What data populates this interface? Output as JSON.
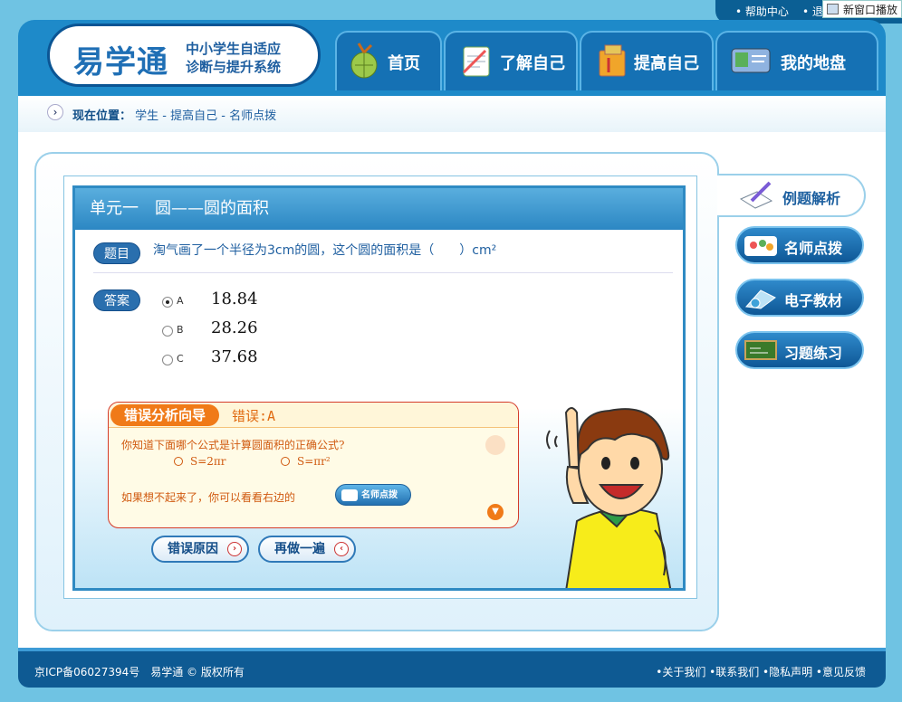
{
  "top": {
    "help": "帮助中心",
    "exit": "退",
    "new_window": "新窗口播放"
  },
  "logo": {
    "title": "易学通",
    "sub1": "中小学生自适应",
    "sub2": "诊断与提升系统"
  },
  "nav": [
    {
      "label": "首页",
      "icon": "globe-icon"
    },
    {
      "label": "了解自己",
      "icon": "notebook-icon"
    },
    {
      "label": "提高自己",
      "icon": "books-icon"
    },
    {
      "label": "我的地盘",
      "icon": "id-card-icon"
    }
  ],
  "breadcrumb": {
    "prefix": "现在位置：",
    "path": "学生 - 提高自己 - 名师点拨"
  },
  "card": {
    "title": "单元一　圆——圆的面积",
    "question_tag": "题目",
    "question": "淘气画了一个半径为3cm的圆，这个圆的面积是（　　）cm²",
    "answer_tag": "答案",
    "options": [
      {
        "key": "A",
        "value": "18.84",
        "selected": true
      },
      {
        "key": "B",
        "value": "28.26",
        "selected": false
      },
      {
        "key": "C",
        "value": "37.68",
        "selected": false
      }
    ]
  },
  "error": {
    "tab": "错误分析向导",
    "label": "错误:A",
    "question": "你知道下面哪个公式是计算圆面积的正确公式?",
    "formula1": "S=2πr",
    "formula2": "S=πr²",
    "hint": "如果想不起来了，你可以看看右边的",
    "mini_button": "名师点拨"
  },
  "actions": {
    "reason": "错误原因",
    "redo": "再做一遍"
  },
  "side": {
    "active": "例题解析",
    "tabs": [
      "名师点拨",
      "电子教材",
      "习题练习"
    ]
  },
  "footer": {
    "left": "京ICP备06027394号　易学通 © 版权所有",
    "right": "•关于我们 •联系我们 •隐私声明 •意见反馈"
  },
  "colors": {
    "brand": "#1e8ac9",
    "accent": "#f07a18",
    "dark": "#0e5a93"
  }
}
